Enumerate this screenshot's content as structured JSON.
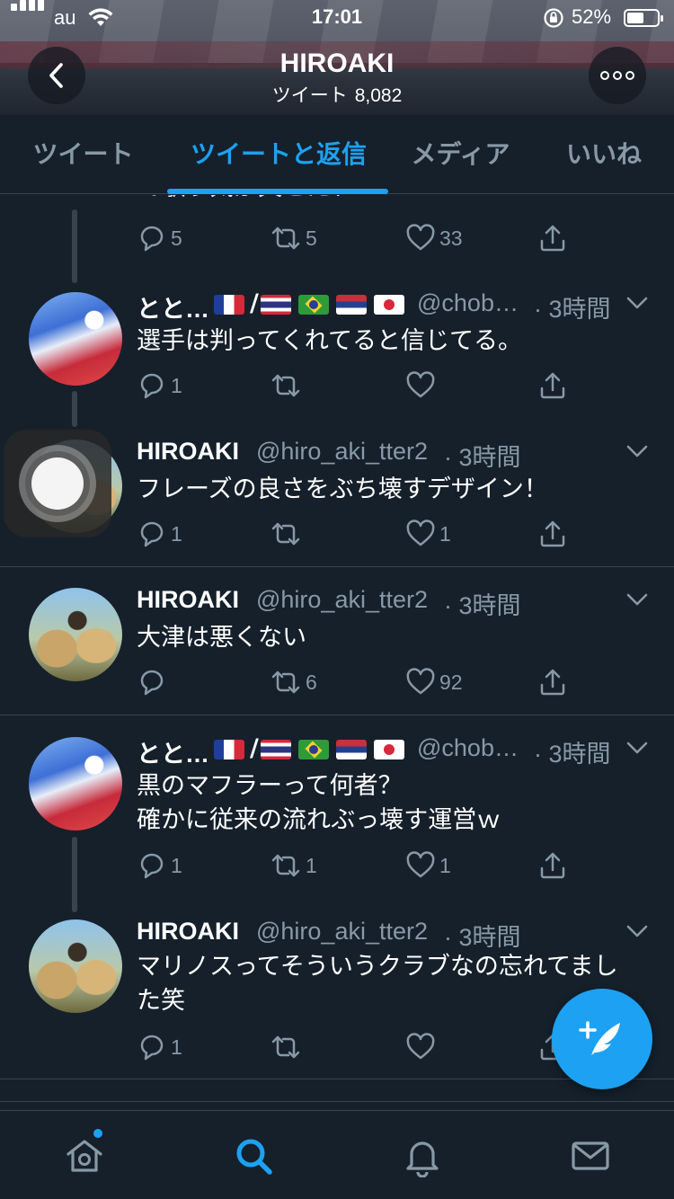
{
  "status_bar": {
    "carrier": "au",
    "time": "17:01",
    "battery": "52%"
  },
  "header": {
    "title": "HIROAKI",
    "tweets_label": "ツイート",
    "tweets_count": "8,082"
  },
  "tabs": [
    {
      "label": "ツイート",
      "active": false
    },
    {
      "label": "ツイートと返信",
      "active": true
    },
    {
      "label": "メディア",
      "active": false
    },
    {
      "label": "いいね",
      "active": false
    }
  ],
  "partial_tweet": {
    "text_fragment": "て歌う気が失せたわ",
    "replies": "5",
    "retweets": "5",
    "likes": "33"
  },
  "tweets": [
    {
      "name": "とと…",
      "name_suffix": "/",
      "flags": [
        "fr",
        "th",
        "br",
        "rs",
        "jp"
      ],
      "handle": "@chob…",
      "time": "· 3時間",
      "text": [
        "選手は判ってくれてると信じてる。"
      ],
      "replies": "1",
      "retweets": "",
      "likes": ""
    },
    {
      "name": "HIROAKI",
      "handle": "@hiro_aki_tter2",
      "time": "· 3時間",
      "text": [
        "フレーズの良さをぶち壊すデザイン！"
      ],
      "replies": "1",
      "retweets": "",
      "likes": "1"
    },
    {
      "name": "HIROAKI",
      "handle": "@hiro_aki_tter2",
      "time": "· 3時間",
      "text": [
        "大津は悪くない"
      ],
      "replies": "",
      "retweets": "6",
      "likes": "92"
    },
    {
      "name": "とと…",
      "name_suffix": "/",
      "flags": [
        "fr",
        "th",
        "br",
        "rs",
        "jp"
      ],
      "handle": "@chob…",
      "time": "· 3時間",
      "text": [
        "黒のマフラーって何者？",
        "確かに従来の流れぶっ壊す運営ｗ"
      ],
      "replies": "1",
      "retweets": "1",
      "likes": "1"
    },
    {
      "name": "HIROAKI",
      "handle": "@hiro_aki_tter2",
      "time": "· 3時間",
      "text": [
        "マリノスってそういうクラブなの忘れてまし",
        "た笑"
      ],
      "replies": "1",
      "retweets": "",
      "likes": ""
    }
  ],
  "tabbar": {
    "items": [
      "home-icon",
      "search-icon",
      "notifications-icon",
      "messages-icon"
    ],
    "active": "search-icon",
    "accent": "#1da1f2"
  },
  "colors": {
    "background": "#15202b",
    "accent": "#1da1f2",
    "muted": "#8899a6",
    "divider": "#38444d"
  }
}
